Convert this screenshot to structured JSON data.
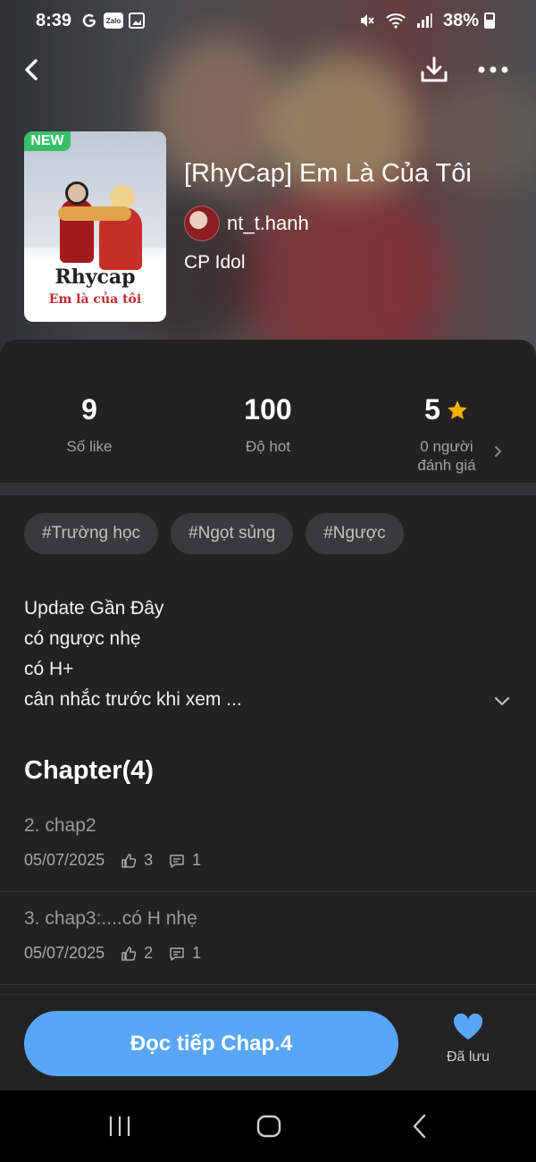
{
  "status_bar": {
    "time": "8:39",
    "battery": "38%",
    "icons": [
      "g-icon",
      "zalo-icon",
      "gallery-icon",
      "mute-icon",
      "wifi-icon",
      "signal-icon",
      "battery-icon"
    ],
    "zalo_label": "Zalo"
  },
  "header": {
    "back_icon": "back-arrow-icon",
    "download_icon": "download-icon",
    "more_icon": "more-dots-icon"
  },
  "story": {
    "badge": "NEW",
    "cover_title": "Rhycap",
    "cover_subtitle": "Em là của tôi",
    "title": "[RhyCap] Em Là Của Tôi",
    "author": "nt_t.hanh",
    "category": "CP Idol"
  },
  "stats": {
    "likes_value": "9",
    "likes_label": "Số like",
    "hot_value": "100",
    "hot_label": "Độ hot",
    "rating_value": "5",
    "rating_label_1": "0 người",
    "rating_label_2": "đánh giá",
    "star_color": "#f5b000"
  },
  "tags": [
    "#Trường học",
    "#Ngọt sủng",
    "#Ngược"
  ],
  "description": {
    "lines": [
      "Update Gần Đây",
      "có ngược nhẹ",
      "có H+",
      "cân nhắc trước khi xem ..."
    ]
  },
  "chapters": {
    "heading": "Chapter(4)",
    "items": [
      {
        "name": "2. chap2",
        "date": "05/07/2025",
        "likes": "3",
        "comments": "1"
      },
      {
        "name": "3. chap3:....có H nhẹ",
        "date": "05/07/2025",
        "likes": "2",
        "comments": "1"
      }
    ]
  },
  "actions": {
    "read_label": "Đọc tiếp Chap.4",
    "saved_label": "Đã lưu",
    "accent": "#58a6f5"
  }
}
